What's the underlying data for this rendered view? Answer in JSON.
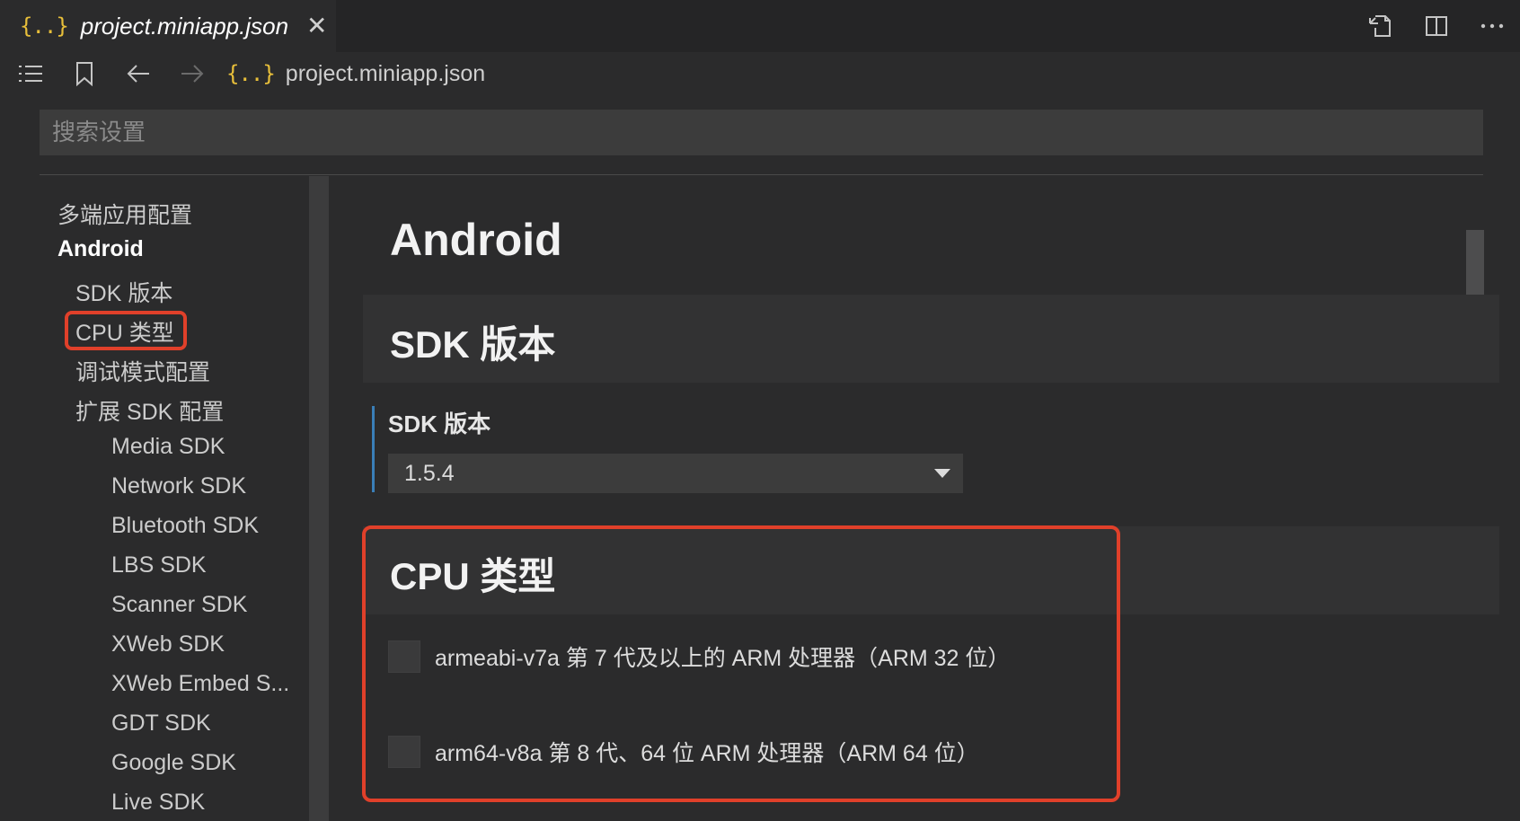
{
  "tab": {
    "icon": "json-braces-icon",
    "icon_text": "{..}",
    "title": "project.miniapp.json",
    "close_glyph": "✕"
  },
  "toolbar": {
    "icon_text": "{..}",
    "breadcrumb": "project.miniapp.json"
  },
  "search": {
    "placeholder": "搜索设置"
  },
  "nav": {
    "items": [
      {
        "label": "多端应用配置"
      },
      {
        "label": "Android"
      },
      {
        "label": "SDK 版本"
      },
      {
        "label": "CPU 类型"
      },
      {
        "label": "调试模式配置"
      },
      {
        "label": "扩展 SDK 配置"
      },
      {
        "label": "Media SDK"
      },
      {
        "label": "Network SDK"
      },
      {
        "label": "Bluetooth SDK"
      },
      {
        "label": "LBS SDK"
      },
      {
        "label": "Scanner SDK"
      },
      {
        "label": "XWeb SDK"
      },
      {
        "label": "XWeb Embed S..."
      },
      {
        "label": "GDT SDK"
      },
      {
        "label": "Google SDK"
      },
      {
        "label": "Live SDK"
      }
    ]
  },
  "content": {
    "page_title": "Android",
    "sdk_section_title": "SDK 版本",
    "sdk_setting_label": "SDK 版本",
    "sdk_version_value": "1.5.4",
    "cpu_section_title": "CPU 类型",
    "cpu_options": [
      {
        "label": "armeabi-v7a 第 7 代及以上的 ARM 处理器（ARM 32 位）",
        "checked": false
      },
      {
        "label": "arm64-v8a 第 8 代、64 位 ARM 处理器（ARM 64 位）",
        "checked": false
      }
    ]
  },
  "colors": {
    "accent_highlight": "#e0402a",
    "json_icon": "#e8bf3a",
    "setting_bar": "#3a7fb8"
  }
}
